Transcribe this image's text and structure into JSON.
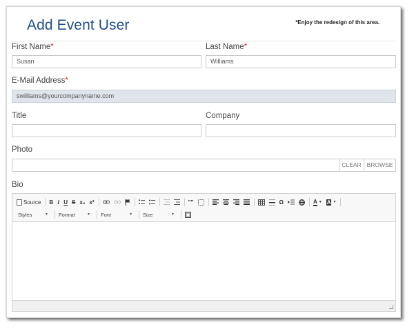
{
  "header": {
    "title": "Add Event User",
    "notice": "*Enjoy the redesign of this area."
  },
  "form": {
    "first_name": {
      "label": "First Name",
      "required": "*",
      "value": "Susan"
    },
    "last_name": {
      "label": "Last Name",
      "required": "*",
      "value": "Williams"
    },
    "email": {
      "label": "E-Mail Address",
      "required": "*",
      "value": "swilliams@yourcompanyname.com"
    },
    "title": {
      "label": "Title",
      "value": ""
    },
    "company": {
      "label": "Company",
      "value": ""
    },
    "photo": {
      "label": "Photo",
      "value": "",
      "clear_label": "CLEAR",
      "browse_label": "BROWSE"
    },
    "bio": {
      "label": "Bio"
    }
  },
  "editor_toolbar": {
    "source_label": "Source",
    "bold": "B",
    "italic": "I",
    "underline": "U",
    "strike": "S",
    "subscript": "x₂",
    "superscript": "x²",
    "combos": {
      "styles": "Styles",
      "format": "Format",
      "font": "Font",
      "size": "Size"
    }
  }
}
